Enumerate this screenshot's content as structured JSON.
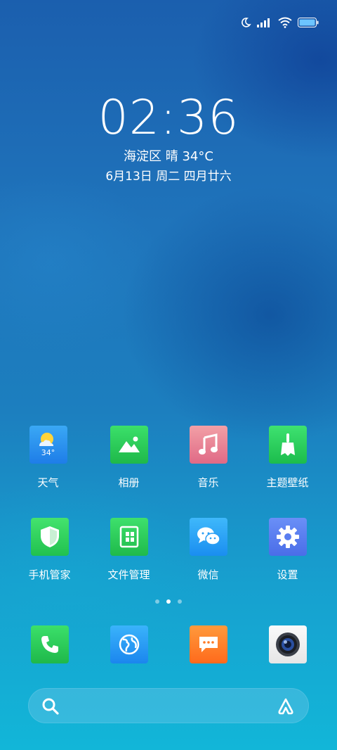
{
  "lockscreen": {
    "time": "02:36",
    "weather_line": "海淀区  晴  34°C",
    "date_line": "6月13日 周二 四月廿六"
  },
  "status_bar": {
    "icons": [
      "moon-icon",
      "signal-icon",
      "wifi-icon",
      "battery-icon"
    ]
  },
  "apps": {
    "weather": {
      "label": "天气",
      "temp": "34°"
    },
    "gallery": {
      "label": "相册"
    },
    "music": {
      "label": "音乐"
    },
    "themes": {
      "label": "主题壁纸"
    },
    "security": {
      "label": "手机管家"
    },
    "files": {
      "label": "文件管理"
    },
    "wechat": {
      "label": "微信"
    },
    "settings": {
      "label": "设置"
    }
  },
  "dock": [
    "phone-icon",
    "browser-icon",
    "messages-icon",
    "camera-icon"
  ],
  "pager": {
    "pages": 3,
    "current": 2
  },
  "search": {
    "left_icon": "search-icon",
    "right_icon": "assistant-icon"
  },
  "colors": {
    "wallpaper": "#1c7fbf",
    "text": "#ffffff"
  }
}
